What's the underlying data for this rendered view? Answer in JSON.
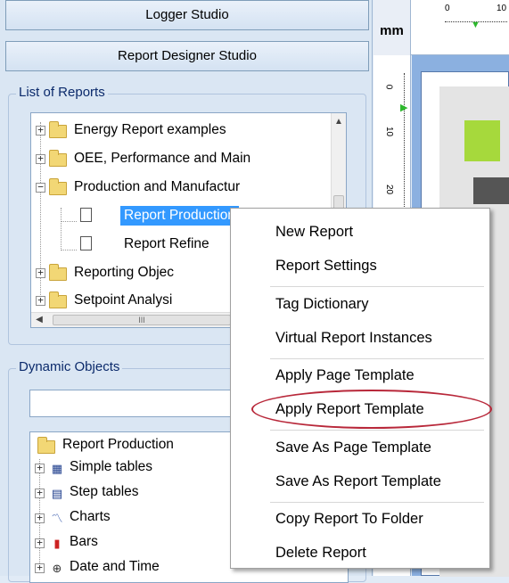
{
  "studio_tabs": {
    "logger": "Logger Studio",
    "report_designer": "Report Designer Studio"
  },
  "list_of_reports": {
    "title": "List of Reports",
    "items": [
      {
        "label": "Energy Report examples"
      },
      {
        "label": "OEE, Performance and Main"
      },
      {
        "label": "Production and Manufactur"
      },
      {
        "label": "Report Production"
      },
      {
        "label": "Report Refine"
      },
      {
        "label": "Reporting Objec"
      },
      {
        "label": "Setpoint Analysi"
      }
    ],
    "scroll_thumb_glyph": "III"
  },
  "dynamic_objects": {
    "title": "Dynamic Objects",
    "search_value": "",
    "root": "Report Production",
    "items": [
      {
        "label": "Simple tables",
        "icon": "table-icon"
      },
      {
        "label": "Step tables",
        "icon": "step-table-icon"
      },
      {
        "label": "Charts",
        "icon": "chart-icon"
      },
      {
        "label": "Bars",
        "icon": "bars-icon"
      },
      {
        "label": "Date and Time",
        "icon": "clock-icon"
      }
    ]
  },
  "ruler": {
    "unit": "mm",
    "top_ticks": [
      "0",
      "10"
    ],
    "left_ticks": [
      "0",
      "10",
      "20"
    ]
  },
  "context_menu": {
    "items": [
      {
        "label": "New Report"
      },
      {
        "label": "Report Settings"
      },
      {
        "label": "Tag Dictionary"
      },
      {
        "label": "Virtual Report Instances"
      },
      {
        "label": "Apply Page Template"
      },
      {
        "label": "Apply Report Template"
      },
      {
        "label": "Save As Page Template"
      },
      {
        "label": "Save As Report Template"
      },
      {
        "label": "Copy Report To Folder"
      },
      {
        "label": "Delete Report"
      }
    ],
    "highlighted_item": "Apply Report Template"
  },
  "colors": {
    "selection": "#3399ff",
    "highlight_oval": "#b8283a",
    "canvas_bg": "#8bb0e0"
  }
}
